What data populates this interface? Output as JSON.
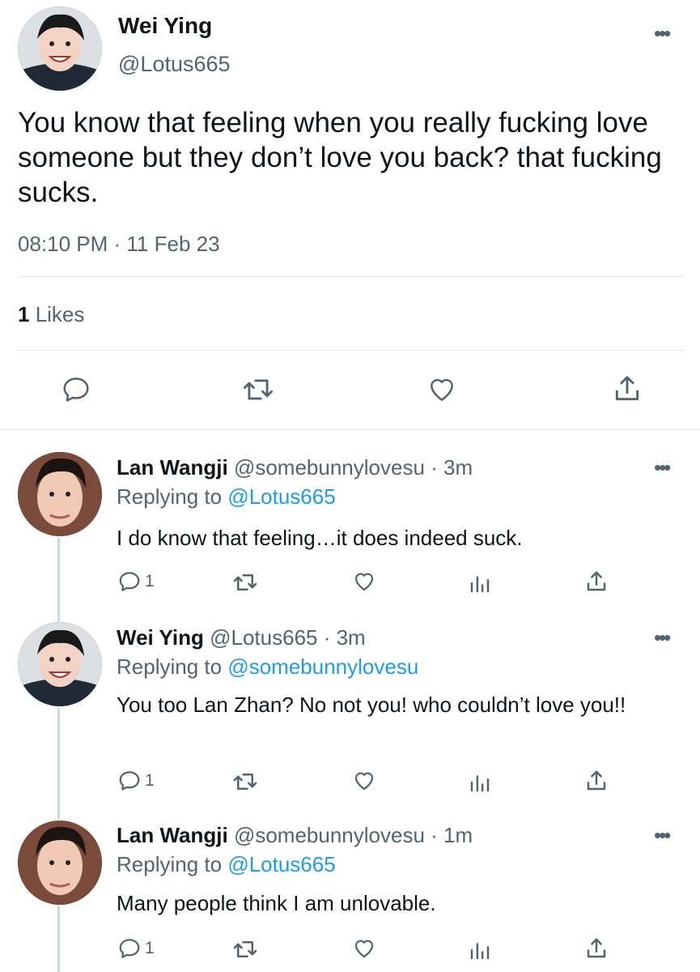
{
  "main_tweet": {
    "author_name": "Wei Ying",
    "handle": "@Lotus665",
    "text": "You know that feeling when you really fucking love someone but they don’t love you back? that fucking sucks.",
    "timestamp": "08:10 PM · 11 Feb 23",
    "likes_count": "1",
    "likes_label": " Likes"
  },
  "replies": [
    {
      "author_name": "Lan Wangji",
      "meta": "@somebunnylovesu · 3m",
      "replying_prefix": "Replying to ",
      "replying_to": "@Lotus665",
      "text": "I do know that feeling…it does indeed suck.",
      "reply_count": "1"
    },
    {
      "author_name": "Wei Ying",
      "meta": "@Lotus665 · 3m",
      "replying_prefix": "Replying to ",
      "replying_to": "@somebunnylovesu",
      "text": "You too Lan Zhan? No not you! who couldn’t love you!!",
      "reply_count": "1"
    },
    {
      "author_name": "Lan Wangji",
      "meta": "@somebunnylovesu · 1m",
      "replying_prefix": "Replying to ",
      "replying_to": "@Lotus665",
      "text": "Many people think I am unlovable.",
      "reply_count": "1"
    }
  ],
  "icons": {
    "more": "more-icon",
    "reply": "reply-icon",
    "retweet": "retweet-icon",
    "like": "heart-icon",
    "share": "share-icon",
    "analytics": "analytics-icon"
  },
  "colors": {
    "text": "#0f1419",
    "secondary": "#536471",
    "link": "#1d9bf0",
    "divider": "#e1e8ed"
  }
}
